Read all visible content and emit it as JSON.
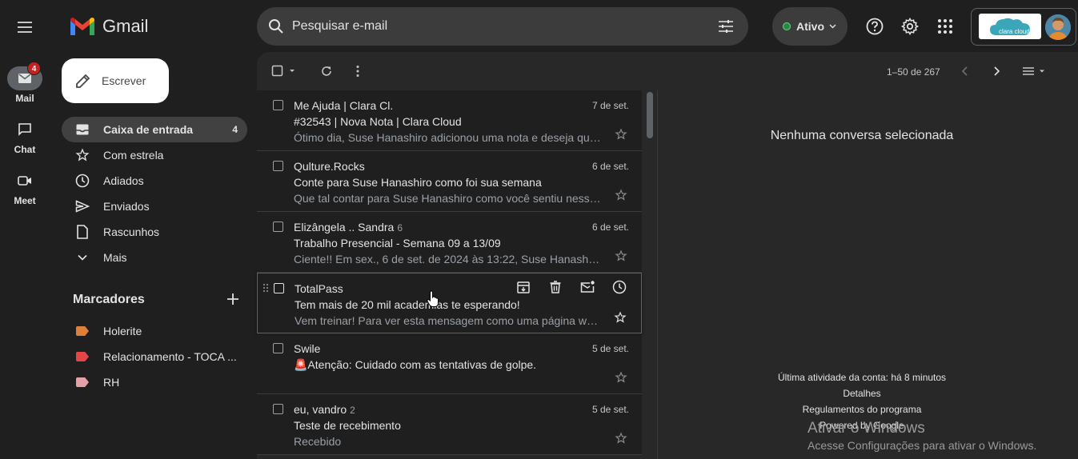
{
  "app": {
    "name": "Gmail"
  },
  "rail": {
    "items": [
      {
        "label": "Mail",
        "badge": "4"
      },
      {
        "label": "Chat"
      },
      {
        "label": "Meet"
      }
    ]
  },
  "compose": {
    "label": "Escrever"
  },
  "nav": {
    "items": [
      {
        "label": "Caixa de entrada",
        "count": "4",
        "icon": "inbox-icon",
        "active": true
      },
      {
        "label": "Com estrela",
        "icon": "star-icon"
      },
      {
        "label": "Adiados",
        "icon": "clock-icon"
      },
      {
        "label": "Enviados",
        "icon": "send-icon"
      },
      {
        "label": "Rascunhos",
        "icon": "draft-icon"
      },
      {
        "label": "Mais",
        "icon": "chevron-down-icon"
      }
    ]
  },
  "labels": {
    "title": "Marcadores",
    "items": [
      {
        "label": "Holerite",
        "color": "#e07f3a"
      },
      {
        "label": "Relacionamento - TOCA ...",
        "color": "#e54545"
      },
      {
        "label": "RH",
        "color": "#e8a0a8"
      }
    ]
  },
  "search": {
    "placeholder": "Pesquisar e-mail"
  },
  "status": {
    "label": "Ativo",
    "color": "#1e8e3e"
  },
  "account": {
    "logo_text": "clara cloud"
  },
  "toolbar": {
    "pager": "1–50 de 267"
  },
  "emails": [
    {
      "sender": "Me Ajuda | Clara Cl.",
      "count": "",
      "date": "7 de set.",
      "subject": "#32543 | Nova Nota | Clara Cloud",
      "snippet": "Ótimo dia, Suse Hanashiro adicionou uma nota e deseja que..."
    },
    {
      "sender": "Qulture.Rocks",
      "count": "",
      "date": "6 de set.",
      "subject": "Conte para Suse Hanashiro como foi sua semana",
      "snippet": "Que tal contar para Suse Hanashiro como você sentiu nessa..."
    },
    {
      "sender": "Elizângela .. Sandra",
      "count": "6",
      "date": "6 de set.",
      "subject": "Trabalho Presencial - Semana 09 a 13/09",
      "snippet": "Ciente!! Em sex., 6 de set. de 2024 às 13:22, Suse Hanashiro ..."
    },
    {
      "sender": "TotalPass",
      "count": "",
      "date": "",
      "subject": "Tem mais de 20 mil academias te esperando!",
      "snippet": "Vem treinar! Para ver esta mensagem como uma página we..."
    },
    {
      "sender": "Swile",
      "count": "",
      "date": "5 de set.",
      "subject": "🚨Atenção: Cuidado com as tentativas de golpe.",
      "snippet": ""
    },
    {
      "sender": "eu, vandro",
      "count": "2",
      "date": "5 de set.",
      "subject": "Teste de recebimento",
      "snippet": "Recebido"
    }
  ],
  "reading": {
    "empty_text": "Nenhuma conversa selecionada",
    "footer": [
      "Última atividade da conta: há 8 minutos",
      "Detalhes",
      "Regulamentos do programa",
      "Powered by Google"
    ]
  },
  "watermark": {
    "title": "Ativar o Windows",
    "subtitle": "Acesse Configurações para ativar o Windows."
  }
}
